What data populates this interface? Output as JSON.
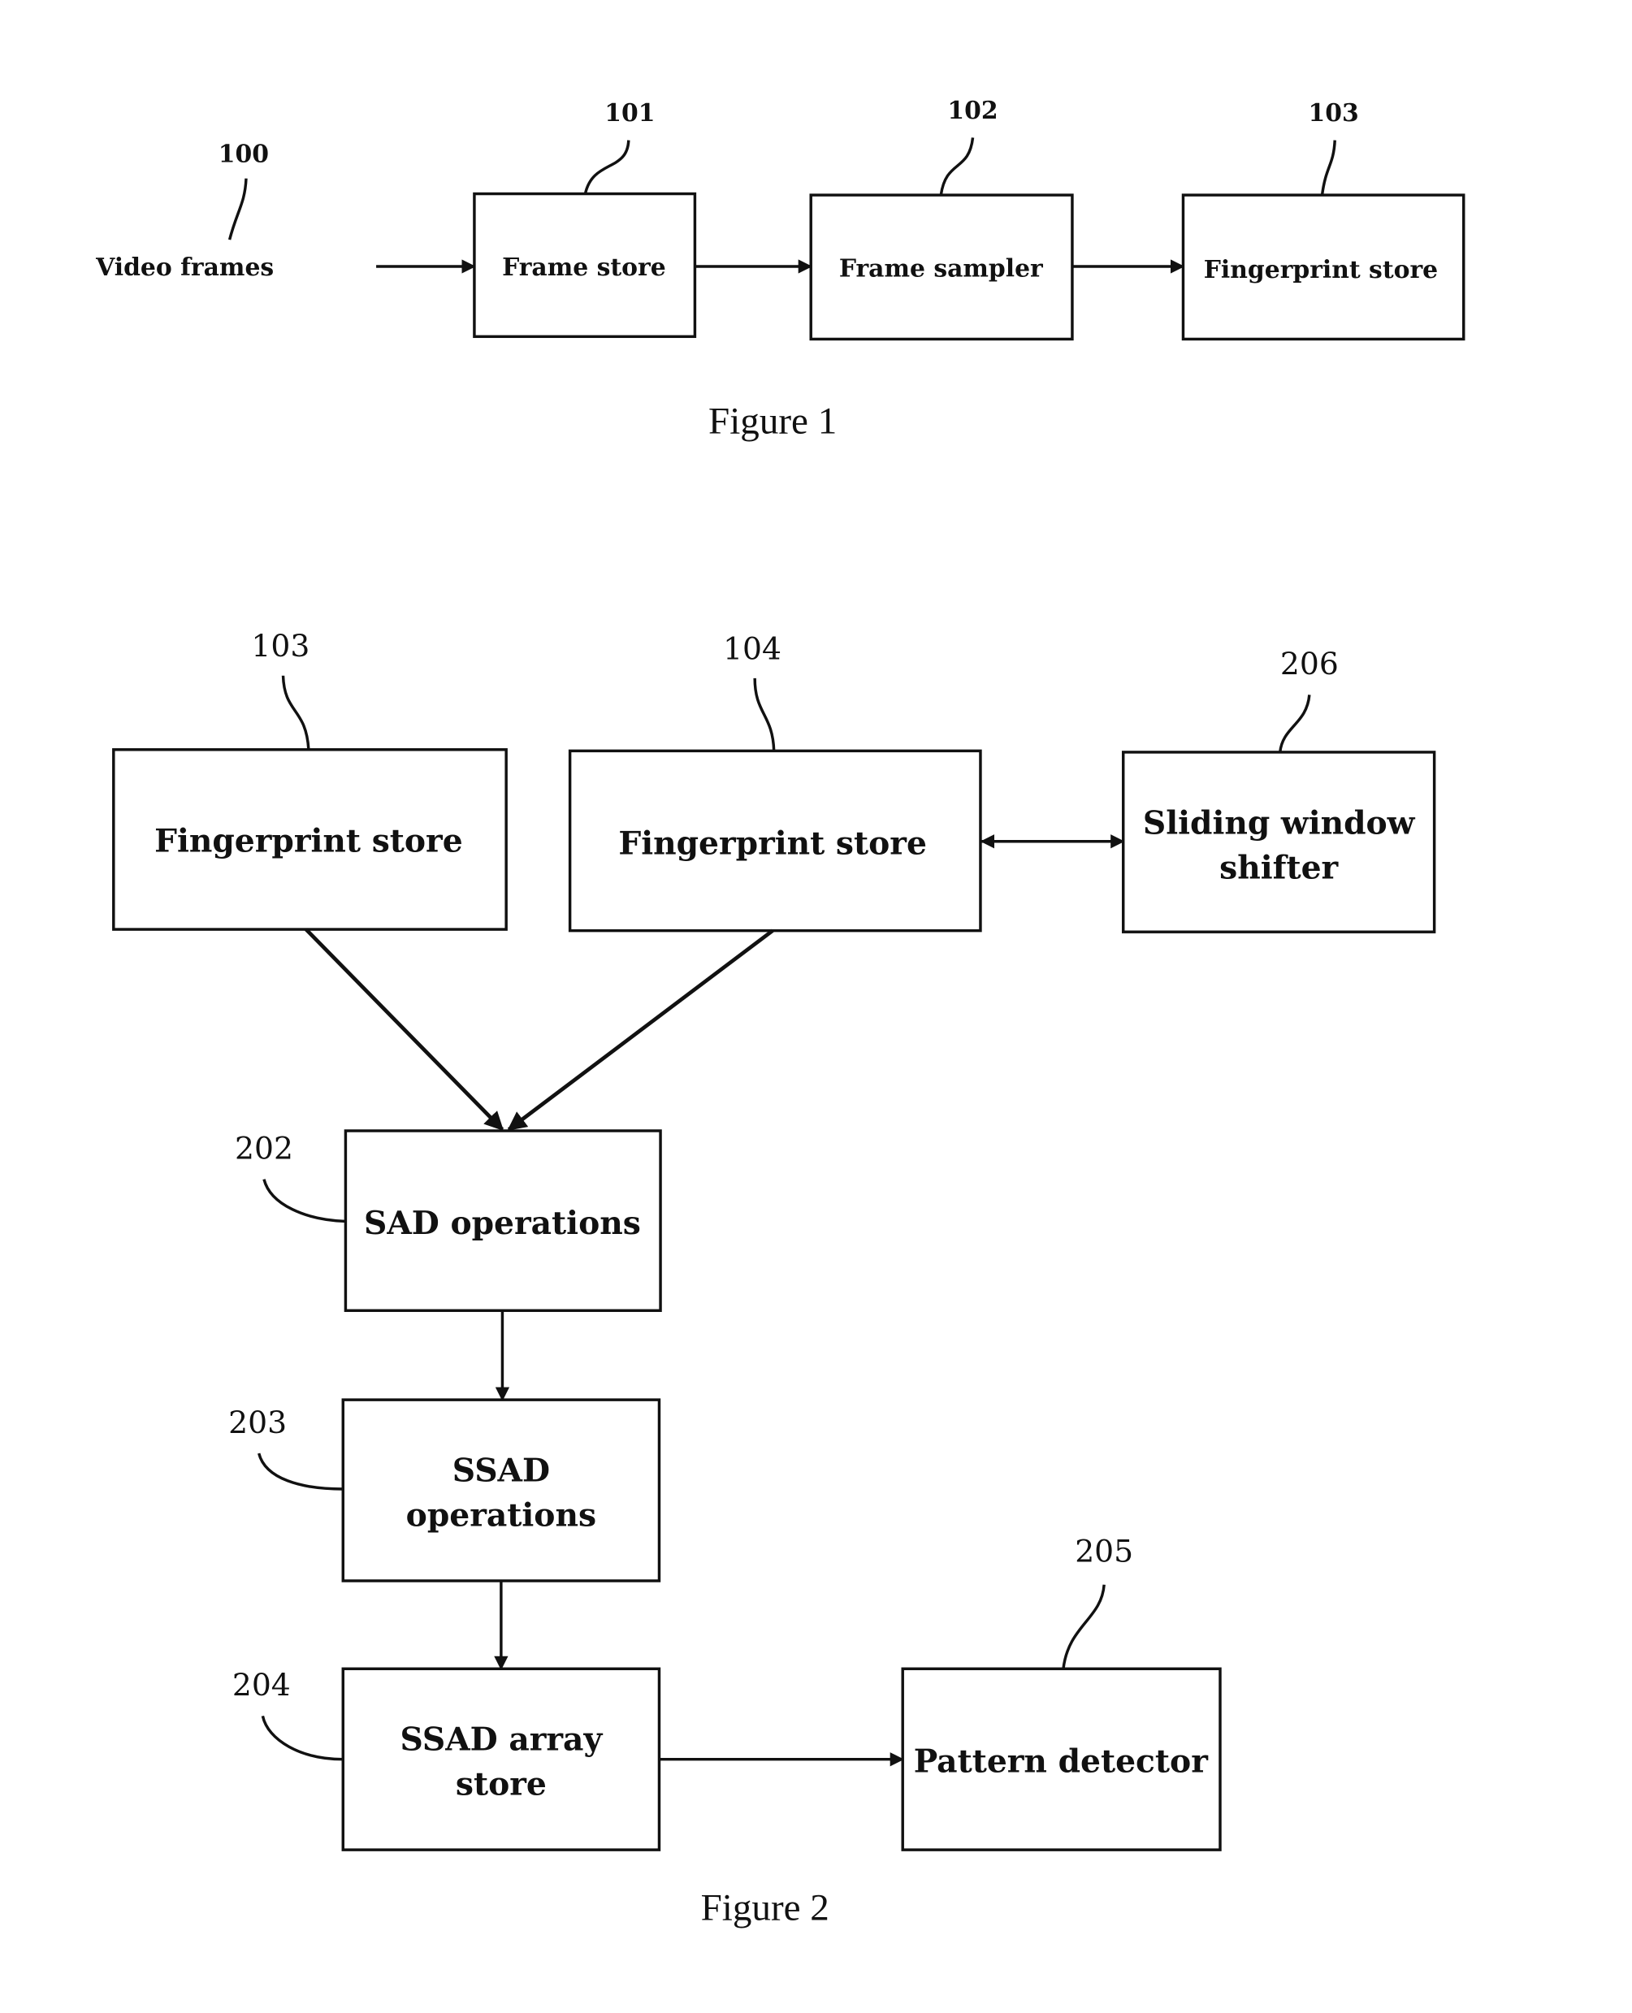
{
  "figure1": {
    "caption": "Figure 1",
    "input": {
      "ref": "100",
      "label": "Video frames"
    },
    "blocks": [
      {
        "ref": "101",
        "label": "Frame store"
      },
      {
        "ref": "102",
        "label": "Frame sampler"
      },
      {
        "ref": "103",
        "label": "Fingerprint store"
      }
    ]
  },
  "figure2": {
    "caption": "Figure 2",
    "blocks": {
      "fp103": {
        "ref": "103",
        "label": "Fingerprint store"
      },
      "fp104": {
        "ref": "104",
        "label": "Fingerprint store"
      },
      "shifter": {
        "ref": "206",
        "line1": "Sliding window",
        "line2": "shifter"
      },
      "sad": {
        "ref": "202",
        "label": "SAD operations"
      },
      "ssad": {
        "ref": "203",
        "line1": "SSAD",
        "line2": "operations"
      },
      "ssad_store": {
        "ref": "204",
        "line1": "SSAD array",
        "line2": "store"
      },
      "pattern": {
        "ref": "205",
        "label": "Pattern detector"
      }
    }
  }
}
